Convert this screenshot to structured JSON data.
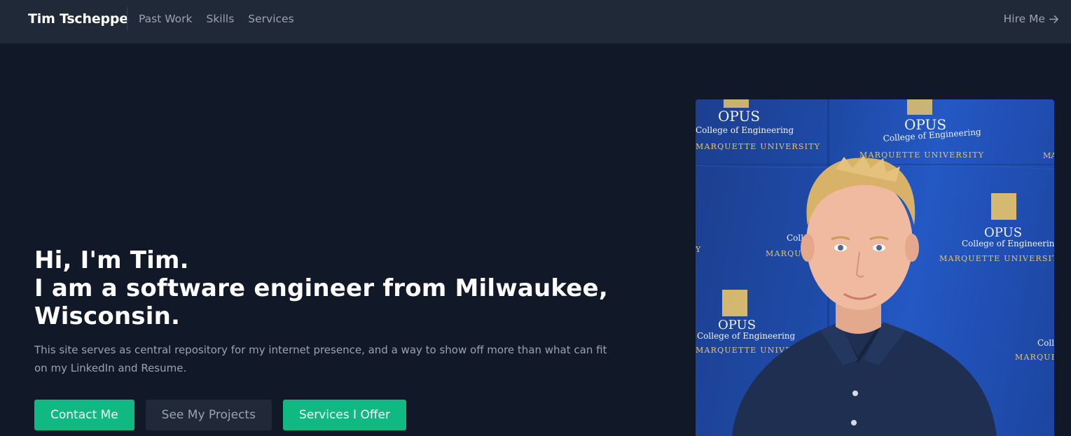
{
  "nav": {
    "brand": "Tim Tscheppe",
    "links": [
      "Past Work",
      "Skills",
      "Services"
    ],
    "hire": "Hire Me"
  },
  "hero": {
    "line1": "Hi, I'm Tim.",
    "line2": "I am a software engineer from Milwaukee,",
    "line3": "Wisconsin.",
    "description": "This site serves as central repository for my internet presence, and a way to show off more than what can fit on my LinkedIn and Resume.",
    "buttons": {
      "contact": "Contact Me",
      "projects": "See My Projects",
      "services": "Services I Offer"
    }
  },
  "photo": {
    "backdrop_logo": {
      "name": "OPUS",
      "college": "College of Engineering",
      "university": "MARQUETTE UNIVERSITY"
    }
  },
  "colors": {
    "background": "#111827",
    "navbar": "#1f2937",
    "accent": "#10b981",
    "muted_text": "#9ca3af"
  },
  "icons": {
    "hire_arrow": "arrow-right-icon"
  }
}
